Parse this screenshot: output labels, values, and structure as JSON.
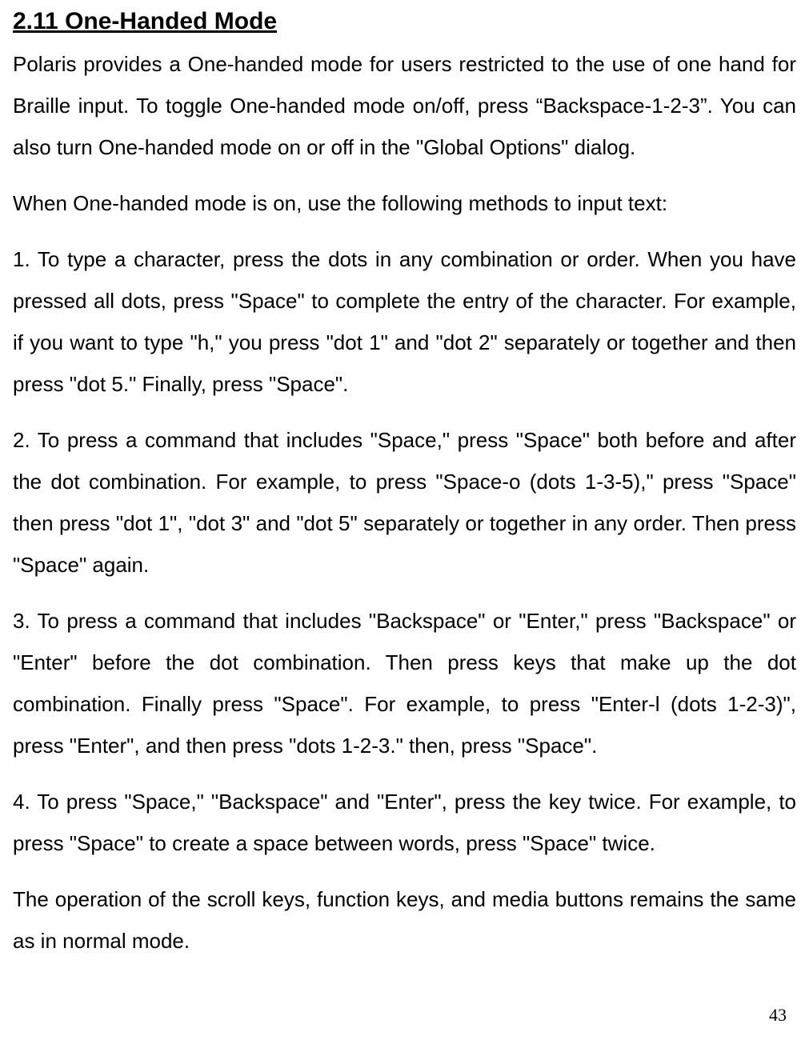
{
  "heading": "2.11 One-Handed Mode",
  "paragraphs": [
    "Polaris provides a One-handed mode for users restricted to the use of one hand for Braille input. To toggle One-handed mode on/off, press “Backspace-1-2-3”. You can also turn One-handed mode on or off in the \"Global Options\" dialog.",
    "When One-handed mode is on, use the following methods to input text:",
    "1. To type a character, press the dots in any combination or order. When you have pressed all dots, press \"Space\" to complete the entry of the character. For example, if you want to type \"h,\" you press \"dot 1\" and \"dot 2\" separately or together and then press \"dot 5.\" Finally, press \"Space\".",
    "2. To press a command that includes \"Space,\" press \"Space\" both before and after the dot combination. For example, to press \"Space-o (dots 1-3-5),\" press \"Space\" then press \"dot 1\", \"dot 3\" and \"dot 5\" separately or together in any order. Then press \"Space\" again.",
    "3. To press a command that includes \"Backspace\" or \"Enter,\" press \"Backspace\" or \"Enter\" before the dot combination. Then press keys that make up the dot combination. Finally press \"Space\". For example, to press \"Enter-l (dots 1-2-3)\", press \"Enter\", and then press \"dots 1-2-3.\" then, press \"Space\".",
    "4. To press \"Space,\" \"Backspace\" and \"Enter\", press the key twice. For example, to press \"Space\" to create a space between words, press \"Space\" twice.",
    "The operation of the scroll keys, function keys, and media buttons remains the same as in normal mode."
  ],
  "page_number": "43"
}
